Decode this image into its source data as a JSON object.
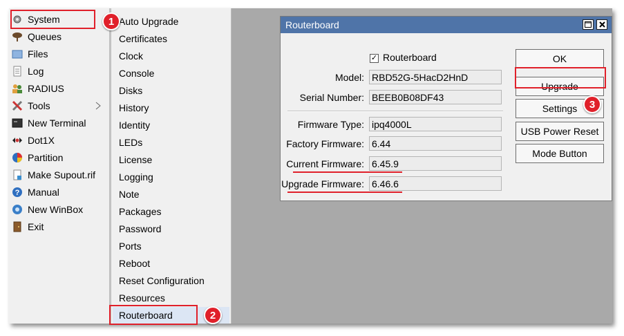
{
  "left_menu": {
    "items": [
      {
        "label": "System",
        "icon": "gear-icon"
      },
      {
        "label": "Queues",
        "icon": "queues-icon"
      },
      {
        "label": "Files",
        "icon": "folder-icon"
      },
      {
        "label": "Log",
        "icon": "log-icon"
      },
      {
        "label": "RADIUS",
        "icon": "users-icon"
      },
      {
        "label": "Tools",
        "icon": "tools-icon"
      },
      {
        "label": "New Terminal",
        "icon": "terminal-icon"
      },
      {
        "label": "Dot1X",
        "icon": "dot1x-icon"
      },
      {
        "label": "Partition",
        "icon": "pie-chart-icon"
      },
      {
        "label": "Make Supout.rif",
        "icon": "document-icon"
      },
      {
        "label": "Manual",
        "icon": "help-icon"
      },
      {
        "label": "New WinBox",
        "icon": "winbox-icon"
      },
      {
        "label": "Exit",
        "icon": "exit-icon"
      }
    ]
  },
  "submenu": {
    "items": [
      "Auto Upgrade",
      "Certificates",
      "Clock",
      "Console",
      "Disks",
      "History",
      "Identity",
      "LEDs",
      "License",
      "Logging",
      "Note",
      "Packages",
      "Password",
      "Ports",
      "Reboot",
      "Reset Configuration",
      "Resources",
      "Routerboard"
    ],
    "selected": "Routerboard"
  },
  "dialog": {
    "title": "Routerboard",
    "checkbox_label": "Routerboard",
    "checkbox_checked": true,
    "fields": [
      {
        "label": "Model:",
        "value": "RBD52G-5HacD2HnD"
      },
      {
        "label": "Serial Number:",
        "value": "BEEB0B08DF43"
      },
      {
        "label": "Firmware Type:",
        "value": "ipq4000L"
      },
      {
        "label": "Factory Firmware:",
        "value": "6.44"
      },
      {
        "label": "Current Firmware:",
        "value": "6.45.9"
      },
      {
        "label": "Upgrade Firmware:",
        "value": "6.46.6"
      }
    ],
    "buttons": [
      "OK",
      "Upgrade",
      "Settings",
      "USB Power Reset",
      "Mode Button"
    ]
  },
  "annotations": {
    "step1": "1",
    "step2": "2",
    "step3": "3"
  },
  "colors": {
    "highlight": "#e0202a",
    "titlebar": "#4f74a8",
    "workspace": "#a9a9a9"
  }
}
